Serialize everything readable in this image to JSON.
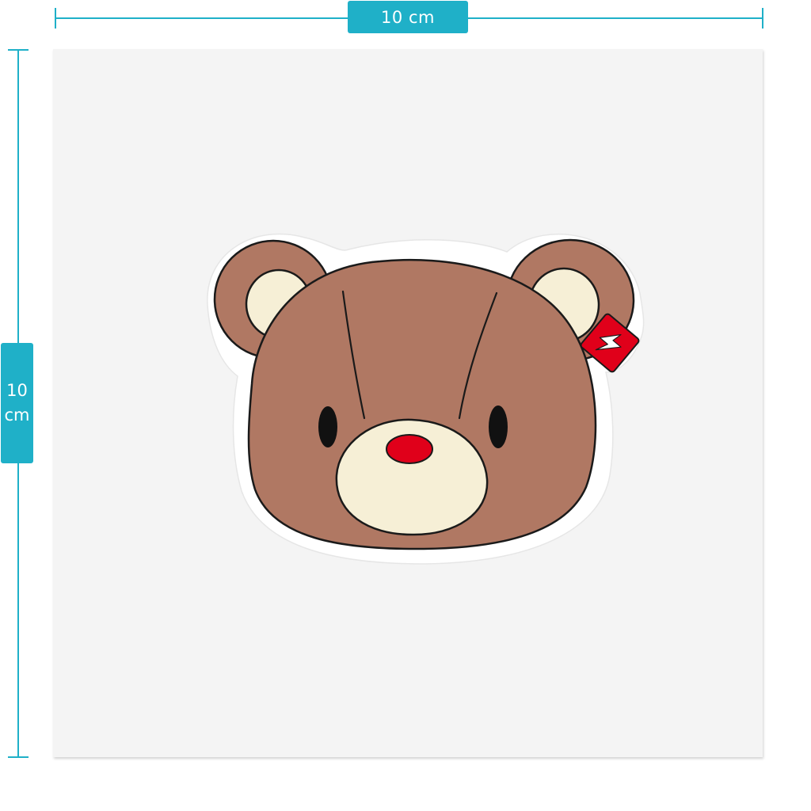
{
  "dimensions": {
    "width_label": "10 cm",
    "height_number": "10",
    "height_unit": "cm"
  },
  "colors": {
    "accent": "#1fb0c8",
    "sheet": "#f4f4f4",
    "fur": "#b07863",
    "muzzle": "#f6efd6",
    "nose": "#e0001a",
    "outline": "#1a1a1a"
  },
  "sticker": {
    "subject": "bear-head",
    "tag_icon": "lightning-bolt-icon"
  }
}
